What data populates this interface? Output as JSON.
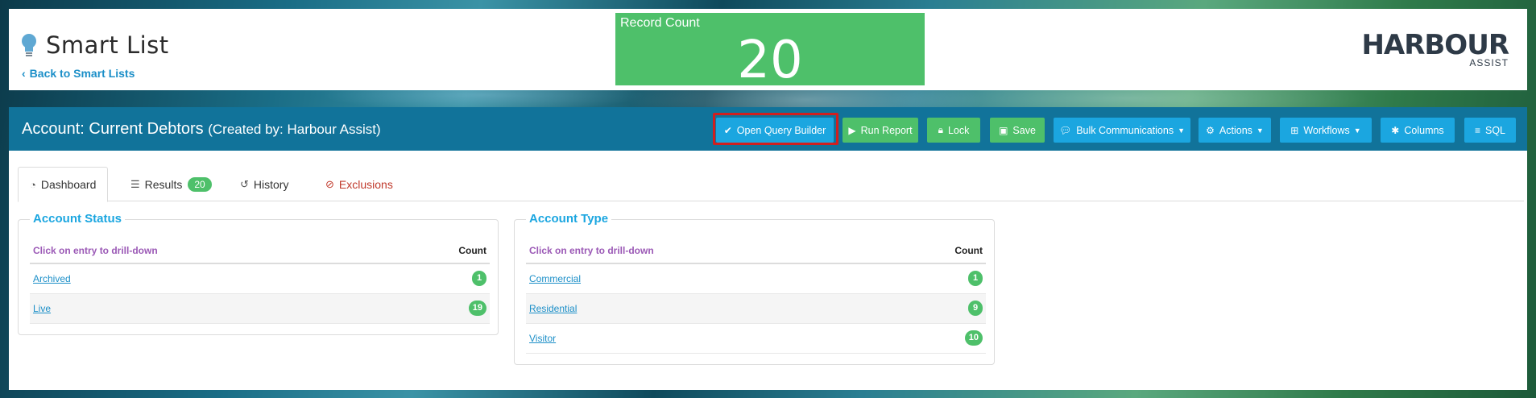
{
  "header": {
    "title": "Smart List",
    "back_link": "Back to Smart Lists",
    "record_count_label": "Record Count",
    "record_count_value": "20",
    "logo_main": "HARBOUR",
    "logo_sub": "ASSIST"
  },
  "bar": {
    "title": "Account: Current Debtors",
    "subtitle": "(Created by: Harbour Assist)",
    "buttons": [
      {
        "label": "Open Query Builder",
        "icon": "check-icon"
      },
      {
        "label": "Run Report",
        "icon": "play-icon"
      },
      {
        "label": "Lock",
        "icon": "lock-icon"
      },
      {
        "label": "Save",
        "icon": "save-icon"
      },
      {
        "label": "Bulk Communications",
        "icon": "comments-icon"
      },
      {
        "label": "Actions",
        "icon": "actions-icon"
      },
      {
        "label": "Workflows",
        "icon": "sitemap-icon"
      },
      {
        "label": "Columns",
        "icon": "cog-icon"
      },
      {
        "label": "SQL",
        "icon": "database-icon"
      }
    ]
  },
  "tabs": [
    {
      "label": "Dashboard",
      "icon": "dashboard-icon"
    },
    {
      "label": "Results",
      "icon": "list-icon",
      "badge": "20"
    },
    {
      "label": "History",
      "icon": "history-icon"
    },
    {
      "label": "Exclusions",
      "icon": "ban-icon"
    }
  ],
  "panels": {
    "status": {
      "title": "Account Status",
      "hint": "Click on entry to drill-down",
      "count_header": "Count",
      "rows": [
        {
          "label": "Archived",
          "count": "1"
        },
        {
          "label": "Live",
          "count": "19"
        }
      ]
    },
    "type": {
      "title": "Account Type",
      "hint": "Click on entry to drill-down",
      "count_header": "Count",
      "rows": [
        {
          "label": "Commercial",
          "count": "1"
        },
        {
          "label": "Residential",
          "count": "9"
        },
        {
          "label": "Visitor",
          "count": "10"
        }
      ]
    }
  },
  "colors": {
    "bar_blue": "#11739a",
    "button_blue": "#1ba6e0",
    "button_green": "#4ec06a",
    "highlight_red": "#d01f1f"
  }
}
